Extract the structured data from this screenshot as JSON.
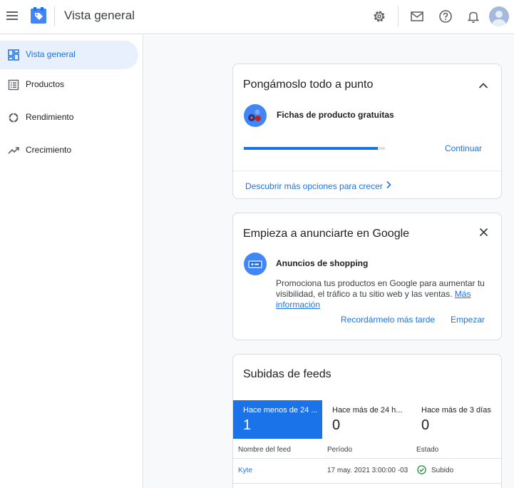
{
  "header": {
    "title": "Vista general",
    "icons": [
      "menu-icon",
      "merchant-center-logo",
      "gear-icon",
      "mail-icon",
      "help-icon",
      "bell-icon",
      "avatar"
    ]
  },
  "sidebar": {
    "items": [
      {
        "label": "Vista general",
        "icon": "dashboard-icon",
        "active": true
      },
      {
        "label": "Productos",
        "icon": "list-icon",
        "active": false
      },
      {
        "label": "Rendimiento",
        "icon": "donut-chart-icon",
        "active": false
      },
      {
        "label": "Crecimiento",
        "icon": "trending-up-icon",
        "active": false
      }
    ]
  },
  "setup_card": {
    "title": "Pongámoslo todo a punto",
    "item_label": "Fichas de producto gratuitas",
    "progress": 0.95,
    "continue_label": "Continuar",
    "discover_label": "Descubrir más opciones para crecer"
  },
  "ads_card": {
    "title": "Empieza a anunciarte en Google",
    "item_label": "Anuncios de shopping",
    "description": "Promociona tus productos en Google para aumentar tu visibilidad, el tráfico a tu sitio web y las ventas.",
    "more_info_label": "Más información",
    "remind_label": "Recordármelo más tarde",
    "start_label": "Empezar"
  },
  "feeds_card": {
    "title": "Subidas de feeds",
    "stats": [
      {
        "label": "Hace menos de 24 ...",
        "value": "1"
      },
      {
        "label": "Hace más de 24 h...",
        "value": "0"
      },
      {
        "label": "Hace más de 3 días",
        "value": "0"
      }
    ],
    "columns": [
      "Nombre del feed",
      "Período",
      "Estado"
    ],
    "rows": [
      {
        "name": "Kyte",
        "period": "17 may. 2021 3:00:00 -03",
        "status": "Subido"
      }
    ]
  },
  "colors": {
    "accent": "#1a73e8",
    "active_bg": "#e8f0fe",
    "success": "#1e8e3e"
  }
}
